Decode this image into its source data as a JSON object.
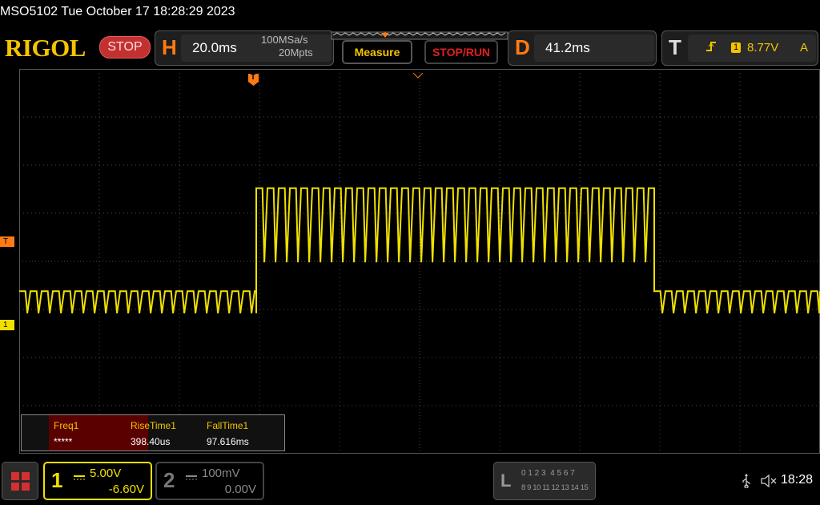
{
  "title": "MSO5102  Tue October 17 18:28:29 2023",
  "brand": "RIGOL",
  "run_state": "STOP",
  "horizontal": {
    "letter": "H",
    "timebase": "20.0ms",
    "sample_rate": "100MSa/s",
    "memory_depth": "20Mpts"
  },
  "buttons": {
    "measure": "Measure",
    "stop_run": "STOP/RUN"
  },
  "delay": {
    "letter": "D",
    "value": "41.2ms"
  },
  "trigger": {
    "letter": "T",
    "source": "1",
    "level": "8.77V",
    "coupling": "A"
  },
  "markers": {
    "trigger_level": "T",
    "channel1": "1",
    "trigger_pos": "T"
  },
  "measurements": {
    "items": [
      {
        "name": "Freq1",
        "value": "*****"
      },
      {
        "name": "RiseTime1",
        "value": "398.40us"
      },
      {
        "name": "FallTime1",
        "value": "97.616ms"
      }
    ]
  },
  "channel1": {
    "number": "1",
    "scale": "5.00V",
    "offset": "-6.60V"
  },
  "channel2": {
    "number": "2",
    "scale": "100mV",
    "offset": "0.00V"
  },
  "logic": {
    "letter": "L",
    "row1": "0 1 2 3  4 5 6 7",
    "row2": "8 9 10 11 12 13 14 15"
  },
  "status": {
    "time": "18:28"
  },
  "colors": {
    "channel1": "#f0e000",
    "trigger": "#ff7a14",
    "stop": "#c23030",
    "grid": "#4a4a4a"
  },
  "waveform": {
    "unit_per_div": 5,
    "segments": [
      {
        "from_ms": -100,
        "to_ms": -40.8,
        "high_v": 3.5,
        "low_v": 1.2,
        "period_ms": 2.8
      },
      {
        "from_ms": -40.8,
        "to_ms": 58.6,
        "high_v": 14.2,
        "low_v": 6.5,
        "period_ms": 2.8
      },
      {
        "from_ms": 58.6,
        "to_ms": 100,
        "high_v": 3.5,
        "low_v": 1.2,
        "period_ms": 2.8
      }
    ]
  }
}
